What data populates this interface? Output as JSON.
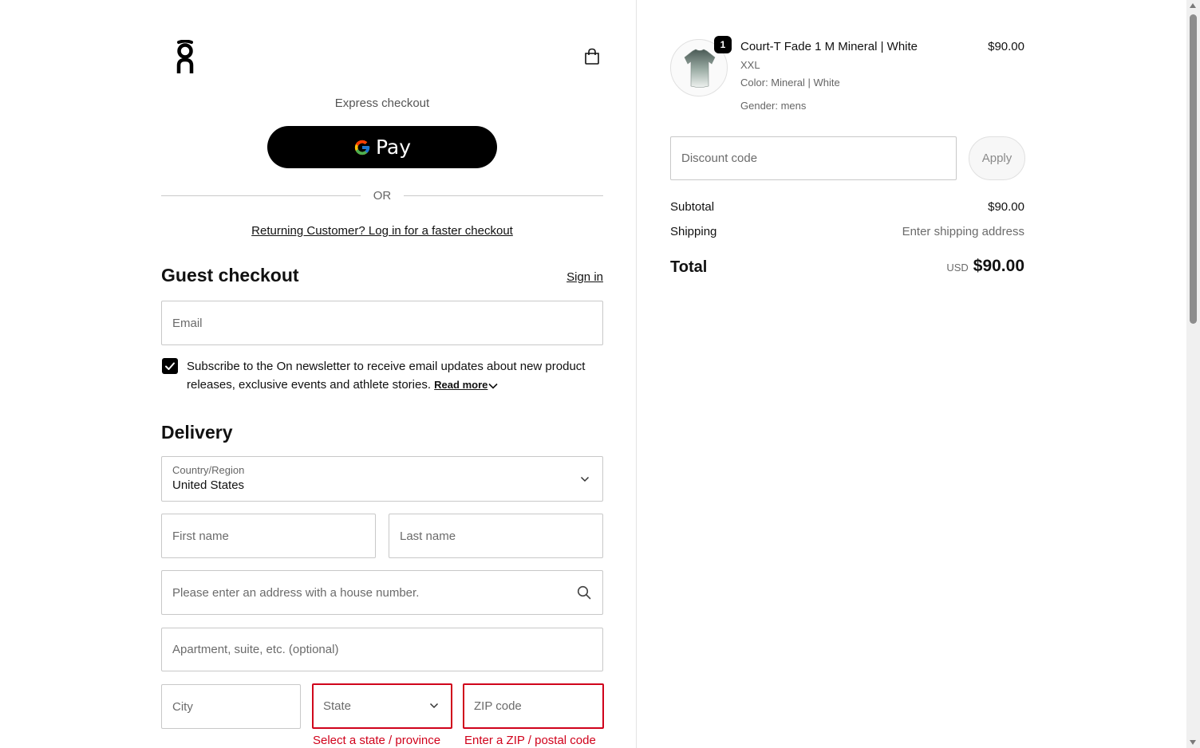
{
  "brand": {
    "logo_icon": "on-logo-icon"
  },
  "header": {
    "cart_icon": "shopping-bag-icon"
  },
  "express": {
    "label": "Express checkout",
    "gpay_label": "Pay",
    "or_text": "OR",
    "returning_link": "Returning Customer? Log in for a faster checkout"
  },
  "guest": {
    "title": "Guest checkout",
    "signin": "Sign in",
    "email_placeholder": "Email",
    "newsletter_checked": true,
    "newsletter_text": "Subscribe to the On newsletter to receive email updates about new product releases, exclusive events and athlete stories.",
    "read_more": "Read more"
  },
  "delivery": {
    "title": "Delivery",
    "country_label": "Country/Region",
    "country_value": "United States",
    "first_name_placeholder": "First name",
    "last_name_placeholder": "Last name",
    "address_placeholder": "Please enter an address with a house number.",
    "apartment_placeholder": "Apartment, suite, etc. (optional)",
    "city_placeholder": "City",
    "state_placeholder": "State",
    "zip_placeholder": "ZIP code",
    "state_error": "Select a state / province",
    "zip_error": "Enter a ZIP / postal code"
  },
  "order": {
    "item": {
      "quantity": "1",
      "name": "Court-T Fade 1 M Mineral | White",
      "price": "$90.00",
      "size": "XXL",
      "color": "Color: Mineral | White",
      "gender": "Gender: mens"
    },
    "discount_placeholder": "Discount code",
    "apply_label": "Apply",
    "subtotal_label": "Subtotal",
    "subtotal_value": "$90.00",
    "shipping_label": "Shipping",
    "shipping_value": "Enter shipping address",
    "total_label": "Total",
    "total_currency": "USD",
    "total_value": "$90.00"
  },
  "colors": {
    "error": "#d0021b",
    "button_dark": "#000000"
  }
}
